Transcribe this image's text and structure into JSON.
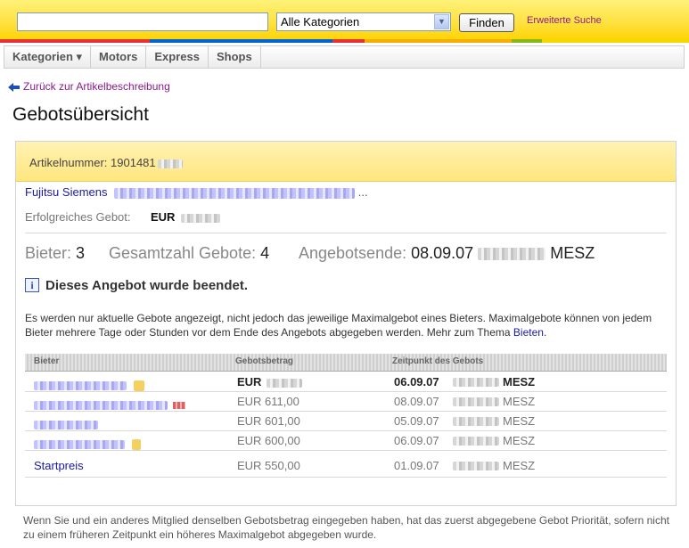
{
  "search": {
    "input_value": "",
    "category_selected": "Alle Kategorien",
    "find_label": "Finden",
    "advanced_label": "Erweiterte Suche"
  },
  "nav": {
    "items": [
      "Kategorien ▾",
      "Motors",
      "Express",
      "Shops"
    ]
  },
  "back_link": "Zurück zur Artikelbeschreibung",
  "page_title": "Gebotsübersicht",
  "item": {
    "number_label": "Artikelnummer: 1901481",
    "title_prefix": "Fujitsu Siemens",
    "title_ellipsis": "...",
    "winning_bid_label": "Erfolgreiches Gebot:",
    "winning_bid_currency": "EUR"
  },
  "stats": {
    "bidders_label": "Bieter:",
    "bidders_value": "3",
    "total_bids_label": "Gesamtzahl Gebote:",
    "total_bids_value": "4",
    "end_label": "Angebotsende:",
    "end_date": "08.09.07",
    "end_tz": "MESZ"
  },
  "ended_message": "Dieses Angebot wurde beendet.",
  "info": {
    "text": "Es werden nur aktuelle Gebote angezeigt, nicht jedoch das jeweilige Maximalgebot eines Bieters. Maximalgebote können von jedem Bieter mehrere Tage oder Stunden vor dem Ende des Angebots abgegeben werden. Mehr zum Thema ",
    "link": "Bieten",
    "end": "."
  },
  "table": {
    "headers": [
      "Bieter",
      "Gebotsbetrag",
      "Zeitpunkt des Gebots"
    ],
    "rows": [
      {
        "amount": "EUR",
        "date": "06.09.07",
        "tz": "MESZ"
      },
      {
        "amount": "EUR 611,00",
        "date": "08.09.07",
        "tz": "MESZ"
      },
      {
        "amount": "EUR 601,00",
        "date": "05.09.07",
        "tz": "MESZ"
      },
      {
        "amount": "EUR 600,00",
        "date": "06.09.07",
        "tz": "MESZ"
      },
      {
        "bidder": "Startpreis",
        "amount": "EUR 550,00",
        "date": "01.09.07",
        "tz": "MESZ"
      }
    ]
  },
  "footnote": "Wenn Sie und ein anderes Mitglied denselben Gebotsbetrag eingegeben haben, hat das zuerst abgegebene Gebot Priorität, sofern nicht zu einem früheren Zeitpunkt ein höheres Maximalgebot abgegeben wurde.",
  "colors": {
    "header_yellow": "#ffd200",
    "link_blue": "#1a1aa6",
    "link_purple": "#8b1a89",
    "stripe": [
      "#e53238",
      "#0064d2",
      "#f5af02",
      "#86b817"
    ]
  }
}
